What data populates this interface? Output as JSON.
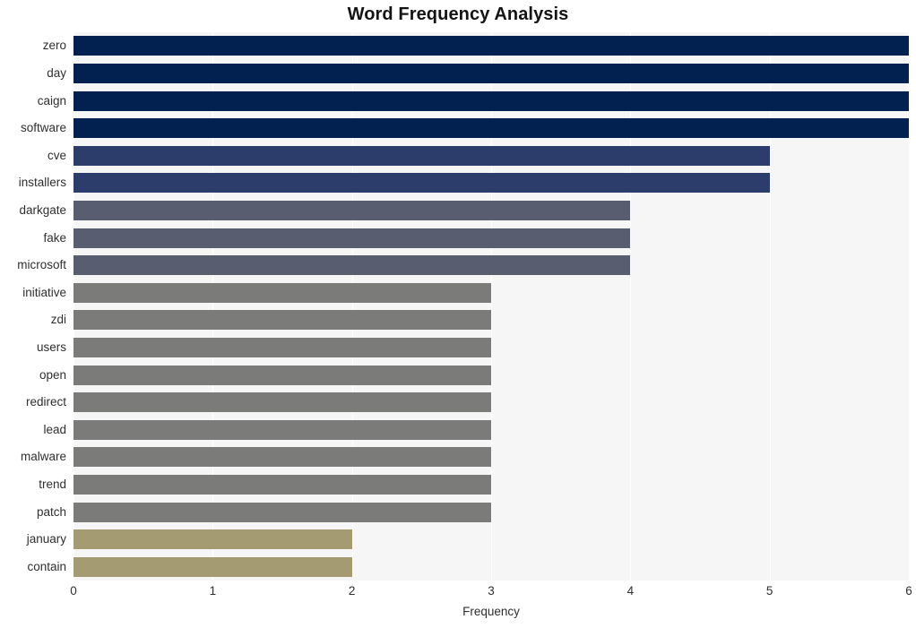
{
  "chart_data": {
    "type": "bar",
    "orientation": "horizontal",
    "title": "Word Frequency Analysis",
    "xlabel": "Frequency",
    "ylabel": "",
    "categories": [
      "zero",
      "day",
      "caign",
      "software",
      "cve",
      "installers",
      "darkgate",
      "fake",
      "microsoft",
      "initiative",
      "zdi",
      "users",
      "open",
      "redirect",
      "lead",
      "malware",
      "trend",
      "patch",
      "january",
      "contain"
    ],
    "values": [
      6,
      6,
      6,
      6,
      5,
      5,
      4,
      4,
      4,
      3,
      3,
      3,
      3,
      3,
      3,
      3,
      3,
      3,
      2,
      2
    ],
    "bar_colors": [
      "#032150",
      "#032150",
      "#032150",
      "#032150",
      "#2c3c6b",
      "#2c3c6b",
      "#585d70",
      "#585d70",
      "#585d70",
      "#7b7b79",
      "#7b7b79",
      "#7b7b79",
      "#7b7b79",
      "#7b7b79",
      "#7b7b79",
      "#7b7b79",
      "#7b7b79",
      "#7b7b79",
      "#a49b72",
      "#a49b72"
    ],
    "xlim": [
      0,
      6
    ],
    "xticks": [
      0,
      1,
      2,
      3,
      4,
      5,
      6
    ],
    "xticklabels": [
      "0",
      "1",
      "2",
      "3",
      "4",
      "5",
      "6"
    ],
    "grid": true,
    "grid_axis": "x",
    "grid_color": "#ffffff",
    "plot_background": "#f6f6f7",
    "figure_background": "#ffffff",
    "legend": null,
    "legend_position": "none"
  }
}
